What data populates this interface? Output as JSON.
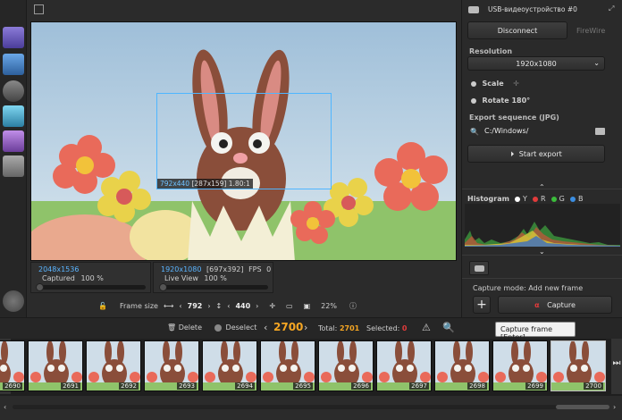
{
  "device": {
    "name": "USB-видеоустройство #0"
  },
  "connection": {
    "disconnect_label": "Disconnect",
    "firewire_label": "FireWire"
  },
  "resolution": {
    "title": "Resolution",
    "value": "1920x1080"
  },
  "options": {
    "scale_label": "Scale",
    "rotate_label": "Rotate 180°"
  },
  "export": {
    "title": "Export sequence (JPG)",
    "path": "C:/Windows/",
    "start_label": "Start export"
  },
  "histogram": {
    "title": "Histogram",
    "channels": [
      {
        "label": "Y",
        "color": "#ffffff"
      },
      {
        "label": "R",
        "color": "#e23b3b"
      },
      {
        "label": "G",
        "color": "#3bbd3b"
      },
      {
        "label": "B",
        "color": "#3b8ee2"
      }
    ]
  },
  "capture": {
    "mode_label": "Capture mode: Add new frame",
    "button_label": "Capture",
    "tooltip": "Capture frame [Enter]"
  },
  "preview": {
    "overlay_size": "792x440",
    "overlay_info": "[287x159]",
    "overlay_ratio": "1.80:1"
  },
  "captured_panel": {
    "resolution": "2048x1536",
    "label": "Captured",
    "value": "100",
    "unit": "%"
  },
  "live_panel": {
    "resolution": "1920x1080",
    "extra": "[697x392]",
    "fps_label": "FPS",
    "fps_value": "0",
    "label": "Live View",
    "value": "100",
    "unit": "%"
  },
  "frame_size": {
    "label": "Frame size",
    "width": "792",
    "height": "440",
    "zoom": "22%"
  },
  "bottom": {
    "delete_label": "Delete",
    "deselect_label": "Deselect",
    "current_frame": "2700",
    "total_label": "Total:",
    "total_value": "2701",
    "selected_label": "Selected:",
    "selected_value": "0"
  },
  "thumbnails": [
    {
      "num": "2690"
    },
    {
      "num": "2691"
    },
    {
      "num": "2692"
    },
    {
      "num": "2693"
    },
    {
      "num": "2694"
    },
    {
      "num": "2695"
    },
    {
      "num": "2696"
    },
    {
      "num": "2697"
    },
    {
      "num": "2698"
    },
    {
      "num": "2699"
    },
    {
      "num": "2700"
    }
  ],
  "colors": {
    "accent": "#f5a623",
    "blue": "#5ab4ff",
    "capture_icon": "#e23b3b"
  }
}
